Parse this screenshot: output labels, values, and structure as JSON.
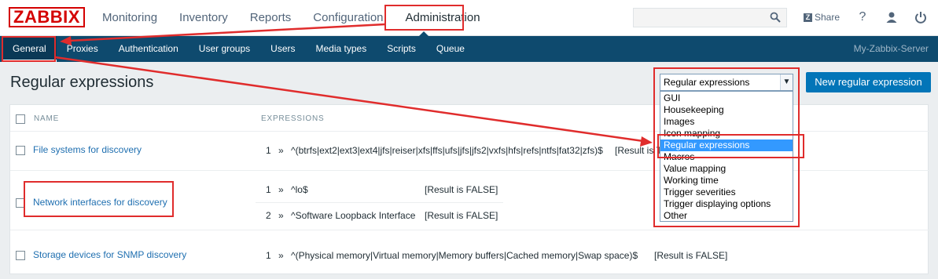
{
  "logo": "ZABBIX",
  "main_nav": [
    "Monitoring",
    "Inventory",
    "Reports",
    "Configuration",
    "Administration"
  ],
  "search": {
    "value": "",
    "placeholder": ""
  },
  "header_actions": {
    "share": "Share",
    "help": "?"
  },
  "sub_nav": [
    "General",
    "Proxies",
    "Authentication",
    "User groups",
    "Users",
    "Media types",
    "Scripts",
    "Queue"
  ],
  "server_name": "My-Zabbix-Server",
  "page_title": "Regular expressions",
  "select": {
    "value": "Regular expressions"
  },
  "new_button": "New regular expression",
  "table": {
    "headers": {
      "name": "NAME",
      "expressions": "EXPRESSIONS"
    },
    "rows": [
      {
        "name": "File systems for discovery",
        "expressions": [
          {
            "num": "1",
            "sep": "»",
            "expr": "^(btrfs|ext2|ext3|ext4|jfs|reiser|xfs|ffs|ufs|jfs|jfs2|vxfs|hfs|refs|ntfs|fat32|zfs)$",
            "result": "[Result is TRUE]"
          }
        ]
      },
      {
        "name": "Network interfaces for discovery",
        "expressions": [
          {
            "num": "1",
            "sep": "»",
            "expr": "^lo$",
            "result": "[Result is FALSE]"
          },
          {
            "num": "2",
            "sep": "»",
            "expr": "^Software Loopback Interface",
            "result": "[Result is FALSE]"
          }
        ]
      },
      {
        "name": "Storage devices for SNMP discovery",
        "expressions": [
          {
            "num": "1",
            "sep": "»",
            "expr": "^(Physical memory|Virtual memory|Memory buffers|Cached memory|Swap space)$",
            "result": "[Result is FALSE]"
          }
        ]
      }
    ]
  },
  "dropdown_options": [
    "GUI",
    "Housekeeping",
    "Images",
    "Icon mapping",
    "Regular expressions",
    "Macros",
    "Value mapping",
    "Working time",
    "Trigger severities",
    "Trigger displaying options",
    "Other"
  ],
  "colors": {
    "annotation_red": "#e02c2c",
    "submenu_bg": "#0e4a6e",
    "primary_button": "#0275b8",
    "selected_option": "#3399ff",
    "link": "#1f6fb0"
  }
}
